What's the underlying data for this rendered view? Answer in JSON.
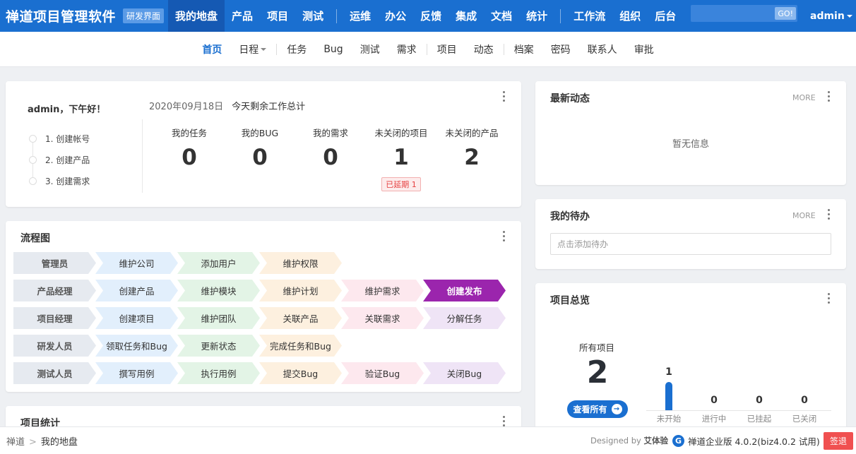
{
  "header": {
    "brand": "禅道项目管理软件",
    "mode_badge": "研发界面",
    "nav": [
      {
        "label": "我的地盘",
        "active": true
      },
      {
        "label": "产品"
      },
      {
        "label": "项目"
      },
      {
        "label": "测试"
      },
      {
        "sep": true
      },
      {
        "label": "运维"
      },
      {
        "label": "办公"
      },
      {
        "label": "反馈"
      },
      {
        "label": "集成"
      },
      {
        "label": "文档"
      },
      {
        "label": "统计"
      },
      {
        "sep": true
      },
      {
        "label": "工作流"
      },
      {
        "label": "组织"
      },
      {
        "label": "后台"
      }
    ],
    "search_placeholder": "",
    "go_label": "GO!",
    "user": "admin"
  },
  "subnav": [
    {
      "label": "首页",
      "active": true
    },
    {
      "label": "日程",
      "dropdown": true
    },
    {
      "sep": true
    },
    {
      "label": "任务"
    },
    {
      "label": "Bug"
    },
    {
      "label": "测试"
    },
    {
      "label": "需求"
    },
    {
      "sep": true
    },
    {
      "label": "项目"
    },
    {
      "label": "动态"
    },
    {
      "sep": true
    },
    {
      "label": "档案"
    },
    {
      "label": "密码"
    },
    {
      "label": "联系人"
    },
    {
      "label": "审批"
    }
  ],
  "welcome": {
    "greeting": "admin，下午好！",
    "steps": [
      "1. 创建帐号",
      "2. 创建产品",
      "3. 创建需求"
    ],
    "date": "2020年09月18日",
    "summary": "今天剩余工作总计",
    "stats": [
      {
        "label": "我的任务",
        "value": "0"
      },
      {
        "label": "我的BUG",
        "value": "0"
      },
      {
        "label": "我的需求",
        "value": "0"
      },
      {
        "label": "未关闭的项目",
        "value": "1",
        "badge": "已延期 1"
      },
      {
        "label": "未关闭的产品",
        "value": "2"
      }
    ]
  },
  "flowchart": {
    "title": "流程图",
    "rows": [
      {
        "role": "管理员",
        "steps": [
          {
            "label": "维护公司",
            "color": "blue"
          },
          {
            "label": "添加用户",
            "color": "green"
          },
          {
            "label": "维护权限",
            "color": "orange"
          }
        ]
      },
      {
        "role": "产品经理",
        "steps": [
          {
            "label": "创建产品",
            "color": "blue"
          },
          {
            "label": "维护模块",
            "color": "green"
          },
          {
            "label": "维护计划",
            "color": "orange"
          },
          {
            "label": "维护需求",
            "color": "pink"
          },
          {
            "label": "创建发布",
            "color": "hl"
          }
        ]
      },
      {
        "role": "项目经理",
        "steps": [
          {
            "label": "创建项目",
            "color": "blue"
          },
          {
            "label": "维护团队",
            "color": "green"
          },
          {
            "label": "关联产品",
            "color": "orange"
          },
          {
            "label": "关联需求",
            "color": "pink"
          },
          {
            "label": "分解任务",
            "color": "purple"
          }
        ]
      },
      {
        "role": "研发人员",
        "steps": [
          {
            "label": "领取任务和Bug",
            "color": "blue"
          },
          {
            "label": "更新状态",
            "color": "green"
          },
          {
            "label": "完成任务和Bug",
            "color": "orange"
          }
        ]
      },
      {
        "role": "测试人员",
        "steps": [
          {
            "label": "撰写用例",
            "color": "blue"
          },
          {
            "label": "执行用例",
            "color": "green"
          },
          {
            "label": "提交Bug",
            "color": "orange"
          },
          {
            "label": "验证Bug",
            "color": "pink"
          },
          {
            "label": "关闭Bug",
            "color": "purple"
          }
        ]
      }
    ]
  },
  "project_stats": {
    "title": "项目统计"
  },
  "dynamic": {
    "title": "最新动态",
    "more": "MORE",
    "empty": "暂无信息"
  },
  "todo": {
    "title": "我的待办",
    "more": "MORE",
    "placeholder": "点击添加待办"
  },
  "overview": {
    "title": "项目总览",
    "all_label": "所有项目",
    "all_value": "2",
    "view_all": "查看所有",
    "chart_data": {
      "type": "bar",
      "categories": [
        "未开始",
        "进行中",
        "已挂起",
        "已关闭"
      ],
      "values": [
        1,
        0,
        0,
        0
      ]
    }
  },
  "footer": {
    "crumb_root": "禅道",
    "crumb_sep": ">",
    "crumb_current": "我的地盘",
    "designed_prefix": "Designed by",
    "designed_by": "艾体验",
    "logo_glyph": "G",
    "version": "禅道企业版 4.0.2(biz4.0.2 试用)",
    "signout": "签退"
  }
}
